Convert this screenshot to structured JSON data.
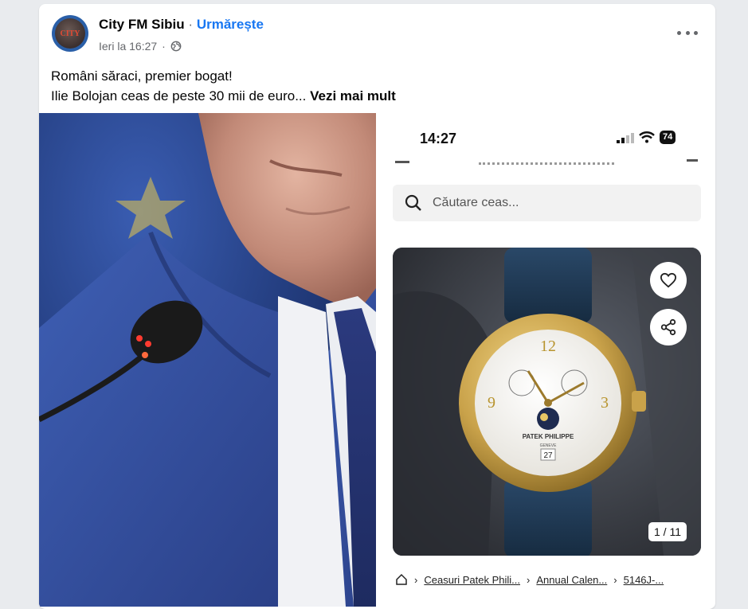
{
  "post": {
    "page_name": "City FM Sibiu",
    "separator": "·",
    "follow_label": "Urmărește",
    "timestamp": "Ieri la 16:27",
    "avatar_text": "CITY",
    "text_line1": "Români săraci, premier bogat!",
    "text_line2": "Ilie Bolojan ceas de peste 30 mii de euro...",
    "see_more_label": "Vezi mai mult",
    "privacy_icon": "globe-icon",
    "more_icon": "more-horizontal-icon"
  },
  "phone": {
    "time": "14:27",
    "battery": "74",
    "search_placeholder": "Căutare ceas...",
    "image_counter": "1 / 11",
    "watch_brand": "PATEK PHILIPPE",
    "watch_city": "GENEVE",
    "watch_numerals": [
      "12",
      "9",
      "3"
    ],
    "watch_date": "27",
    "breadcrumb": [
      "Ceasuri Patek Phili...",
      "Annual Calen...",
      "5146J-..."
    ]
  },
  "colors": {
    "link_blue": "#1877f2",
    "suit_blue": "#2a4486",
    "gold": "#c9a24a",
    "strap_blue": "#1d3550"
  }
}
